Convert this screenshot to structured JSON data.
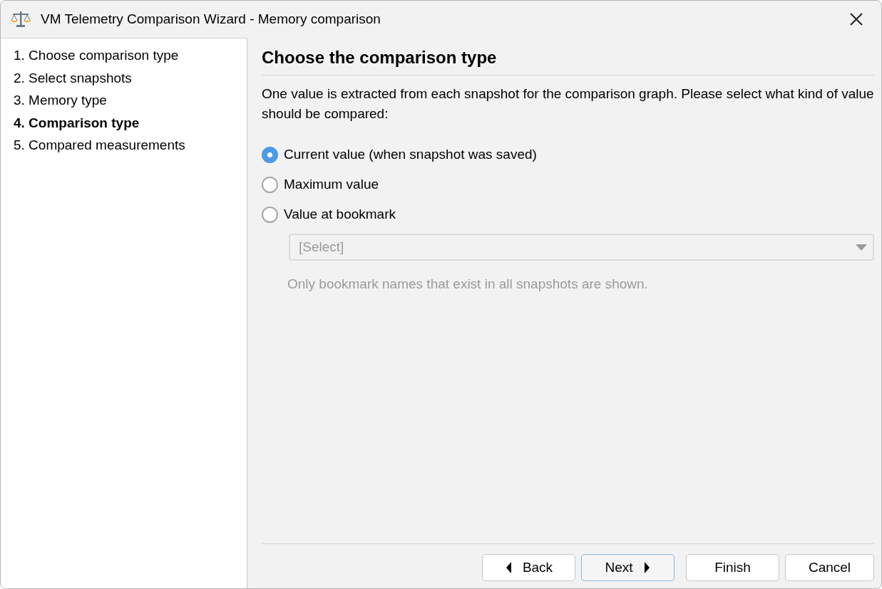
{
  "window": {
    "title": "VM Telemetry Comparison Wizard - Memory comparison"
  },
  "steps": [
    {
      "label": "1. Choose comparison type",
      "selected": false
    },
    {
      "label": "2. Select snapshots",
      "selected": false
    },
    {
      "label": "3. Memory type",
      "selected": false
    },
    {
      "label": "4. Comparison type",
      "selected": true
    },
    {
      "label": "5. Compared measurements",
      "selected": false
    }
  ],
  "page": {
    "heading": "Choose the comparison type",
    "description": "One value is extracted from each snapshot for the comparison graph. Please select what kind of value should be compared:",
    "options": [
      {
        "label": "Current value (when snapshot was saved)",
        "selected": true
      },
      {
        "label": "Maximum value",
        "selected": false
      },
      {
        "label": "Value at bookmark",
        "selected": false
      }
    ],
    "bookmark_select": {
      "value": "[Select]",
      "disabled": true
    },
    "hint": "Only bookmark names that exist in all snapshots are shown."
  },
  "buttons": [
    {
      "label": "Back",
      "kind": "back",
      "default": false
    },
    {
      "label": "Next",
      "kind": "next",
      "default": true
    },
    {
      "label": "Finish",
      "kind": "plain",
      "default": false
    },
    {
      "label": "Cancel",
      "kind": "plain",
      "default": false
    }
  ]
}
